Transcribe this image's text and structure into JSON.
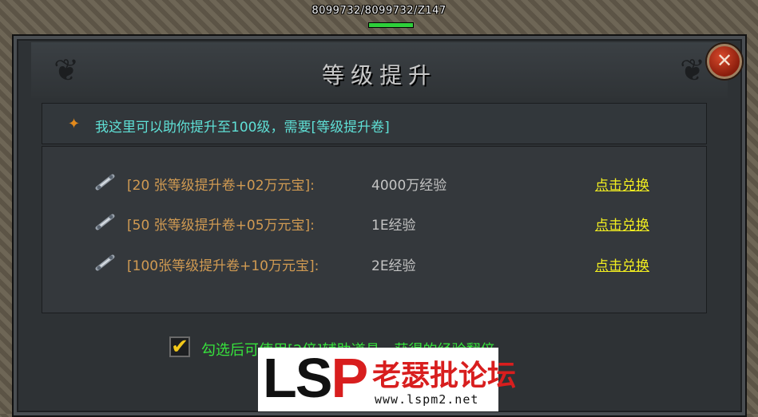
{
  "hud": {
    "hp_text": "8099732/8099732/Z147",
    "hp_fraction": 1.0,
    "hp_bar_color": "#2ecf3a"
  },
  "dialog": {
    "title": "等级提升",
    "close_icon": "close-icon",
    "notice": {
      "icon": "diamond-star-icon",
      "text": "我这里可以助你提升至100级，需要[等级提升卷]"
    },
    "options": [
      {
        "label": "[20 张等级提升卷+02万元宝]:",
        "reward": "4000万经验",
        "button": "点击兑换",
        "icon": "scroll-icon"
      },
      {
        "label": "[50 张等级提升卷+05万元宝]:",
        "reward": "1E经验",
        "button": "点击兑换",
        "icon": "scroll-icon"
      },
      {
        "label": "[100张等级提升卷+10万元宝]:",
        "reward": "2E经验",
        "button": "点击兑换",
        "icon": "scroll-icon"
      }
    ],
    "checkbox": {
      "checked": true,
      "text": "勾选后可使用[2倍]辅助道具，获得的经验翻倍"
    }
  },
  "watermark": {
    "logo_l": "L",
    "logo_s": "S",
    "logo_p": "P",
    "name": "老瑟批论坛",
    "url": "www.lspm2.net"
  },
  "colors": {
    "label": "#d09a52",
    "reward": "#c4c4c4",
    "button": "#f2ee20",
    "notice": "#5fe0d6",
    "checkbox_text": "#37e23c"
  }
}
